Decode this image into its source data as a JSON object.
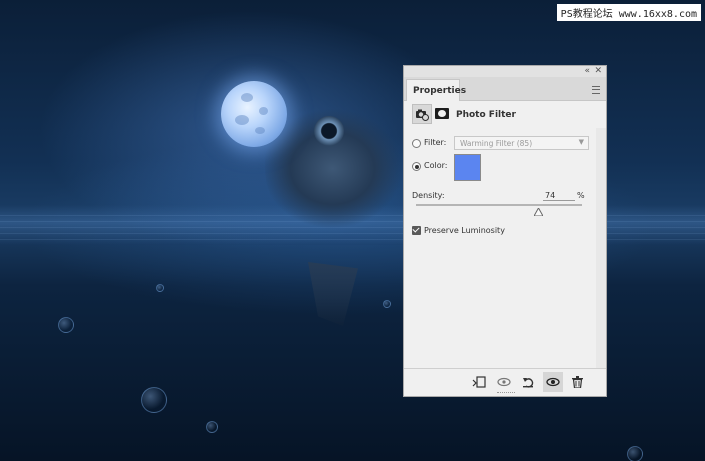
{
  "watermark": "PS教程论坛 www.16xx8.com",
  "panel": {
    "tab_label": "Properties",
    "adjustment_title": "Photo Filter",
    "filter": {
      "label": "Filter:",
      "value": "Warming Filter (85)",
      "selected": false
    },
    "color": {
      "label": "Color:",
      "selected": true,
      "swatch": "#5b85f0"
    },
    "density": {
      "label": "Density:",
      "value": "74",
      "unit": "%",
      "level": 0.74
    },
    "preserve_luminosity": {
      "label": "Preserve Luminosity",
      "checked": true
    }
  },
  "colors": {
    "panel_bg": "#f0f0f0",
    "swatch": "#5b85f0",
    "scene_accent": "#1b3e66"
  },
  "footer_icons": [
    "clip-to-layer-icon",
    "view-previous-state-icon",
    "reset-icon",
    "visibility-eye-icon",
    "trash-icon"
  ]
}
